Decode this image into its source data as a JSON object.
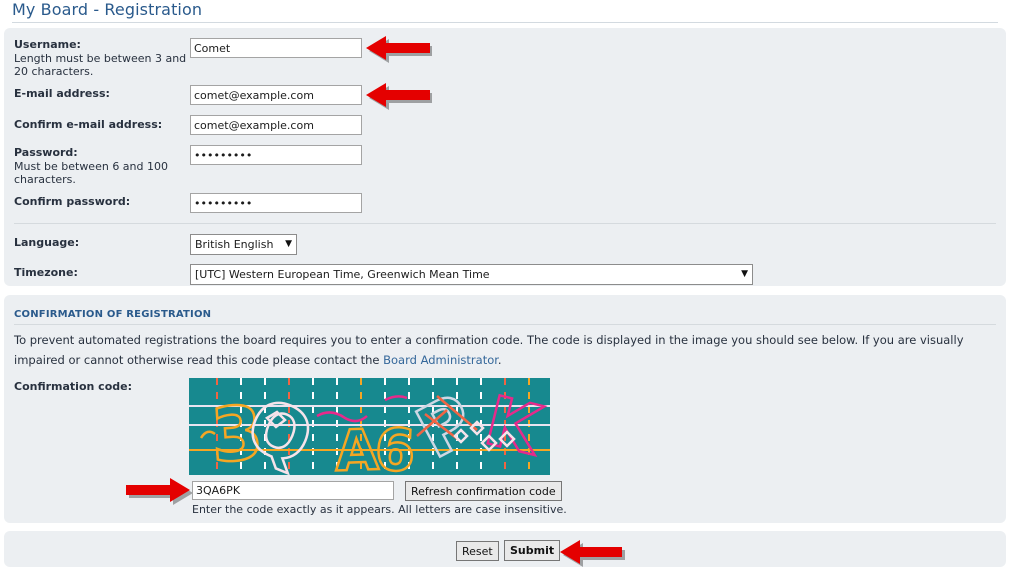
{
  "page": {
    "title": "My Board - Registration",
    "background": "#eceff2",
    "accent": "#2a5a8c",
    "link_color": "#34679a"
  },
  "form": {
    "fields": [
      {
        "name": "username",
        "label": "Username:",
        "hint": "Length must be between 3 and 20 characters.",
        "value": "Comet",
        "placeholder": "",
        "type": "text"
      },
      {
        "name": "email",
        "label": "E-mail address:",
        "hint": "",
        "value": "comet@example.com",
        "placeholder": "",
        "type": "text"
      },
      {
        "name": "email_confirm",
        "label": "Confirm e-mail address:",
        "hint": "",
        "value": "comet@example.com",
        "placeholder": "",
        "type": "text"
      },
      {
        "name": "password",
        "label": "Password:",
        "hint": "Must be between 6 and 100 characters.",
        "value": "secret123",
        "placeholder": "",
        "type": "password"
      },
      {
        "name": "password_confirm",
        "label": "Confirm password:",
        "hint": "",
        "value": "secret123",
        "placeholder": "",
        "type": "password"
      }
    ],
    "language": {
      "label": "Language:",
      "value": "British English",
      "caret": "▼"
    },
    "timezone": {
      "label": "Timezone:",
      "value": "[UTC] Western European Time, Greenwich Mean Time",
      "caret": "▼"
    }
  },
  "confirmation": {
    "heading": "CONFIRMATION OF REGISTRATION",
    "body_part1": "To prevent automated registrations the board requires you to enter a confirmation code. The code is displayed in the image you should see below. If you are visually impaired or cannot otherwise read this code please contact the ",
    "body_link": "Board Administrator",
    "body_part2": ".",
    "code_label": "Confirmation code:",
    "code_value": "3QA6PK",
    "code_placeholder": "",
    "refresh_label": "Refresh confirmation code",
    "code_hint": "Enter the code exactly as it appears. All letters are case insensitive.",
    "captcha": {
      "text": "3QA6PK",
      "background": "#17898f",
      "glyphs": [
        {
          "char": "3",
          "color": "#f5a623"
        },
        {
          "char": "Q",
          "color": "#f6e3ea"
        },
        {
          "char": "A",
          "color": "#f5a623"
        },
        {
          "char": "6",
          "color": "#f5a623"
        },
        {
          "char": "P",
          "color": "#cdd7e3"
        },
        {
          "char": "K",
          "color": "#e62a8b"
        }
      ],
      "noise_colors": [
        "#ffffff",
        "#f5a623",
        "#f06543",
        "#e62a8b"
      ]
    }
  },
  "footer": {
    "reset_label": "Reset",
    "submit_label": "Submit"
  },
  "annotations": {
    "arrow_color": "#e40000",
    "arrows": [
      {
        "name": "arrow-username",
        "direction": "left"
      },
      {
        "name": "arrow-email",
        "direction": "left"
      },
      {
        "name": "arrow-confirmation-code",
        "direction": "right"
      },
      {
        "name": "arrow-submit",
        "direction": "left"
      }
    ]
  }
}
